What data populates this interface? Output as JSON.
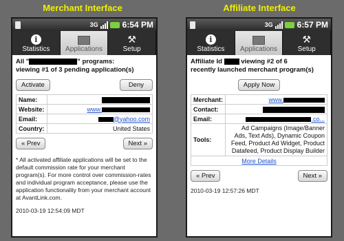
{
  "merchant": {
    "title": "Merchant Interface",
    "status": {
      "clock": "6:54 PM",
      "network": "3G"
    },
    "tabs": [
      {
        "label": "Statistics",
        "icon": "info-icon"
      },
      {
        "label": "Applications",
        "icon": "screen-icon",
        "active": true
      },
      {
        "label": "Setup",
        "icon": "tools-icon"
      }
    ],
    "heading_prefix": "All \"",
    "heading_suffix": "\" programs:",
    "heading_line2": "viewing #1 of 3 pending application(s)",
    "activate_label": "Activate",
    "deny_label": "Deny",
    "rows": [
      {
        "label": "Name:",
        "value": ""
      },
      {
        "label": "Website:",
        "value": "www."
      },
      {
        "label": "Email:",
        "value": "@yahoo.com"
      },
      {
        "label": "Country:",
        "value": "United States"
      }
    ],
    "prev_label": "« Prev",
    "next_label": "Next »",
    "note": "* All activated affiliate applications will be set to the default commission rate for your merchant program(s). For more control over commission-rates and individual program acceptance, please use the application functionality from your merchant account at AvantLink.com.",
    "timestamp": "2010-03-19 12:54:09 MDT"
  },
  "affiliate": {
    "title": "Affiliate Interface",
    "status": {
      "clock": "6:57 PM",
      "network": "3G"
    },
    "tabs": [
      {
        "label": "Statistics",
        "icon": "info-icon"
      },
      {
        "label": "Applications",
        "icon": "screen-icon",
        "active": true
      },
      {
        "label": "Setup",
        "icon": "tools-icon"
      }
    ],
    "heading_prefix": "Affiliate Id",
    "heading_suffix": "viewing #2 of 6",
    "heading_line2": "recently launched merchant program(s)",
    "apply_label": "Apply Now",
    "rows": [
      {
        "label": "Merchant:",
        "value": "www."
      },
      {
        "label": "Contact:",
        "value": ""
      },
      {
        "label": "Email:",
        "value": ".co..."
      },
      {
        "label": "Tools:",
        "value": "Ad Campaigns (Image/Banner Ads, Text Ads), Dynamic Coupon Feed, Product Ad Widget, Product Datafeed, Product Display Builder"
      }
    ],
    "more_details": "More Details",
    "prev_label": "« Prev",
    "next_label": "Next »",
    "timestamp": "2010-03-19 12:57:26 MDT"
  }
}
